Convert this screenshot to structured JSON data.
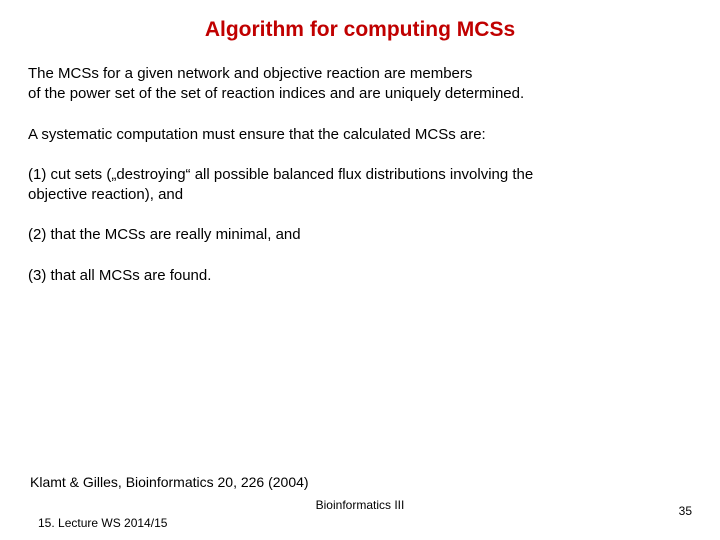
{
  "title": "Algorithm for computing MCSs",
  "paragraphs": {
    "p1a": "The MCSs for a given network and objective reaction are members",
    "p1b": "of the power set of the set of reaction indices and are uniquely determined.",
    "p2": "A systematic computation must ensure that the calculated MCSs are:",
    "p3a": "(1) cut sets („destroying“ all possible balanced flux distributions involving the",
    "p3b": "objective reaction), and",
    "p4": "(2) that the MCSs are really minimal, and",
    "p5": "(3) that all MCSs are found."
  },
  "citation": "Klamt & Gilles, Bioinformatics 20, 226 (2004)",
  "footer": {
    "center": "Bioinformatics III",
    "left": "15. Lecture WS 2014/15",
    "right": "35"
  }
}
